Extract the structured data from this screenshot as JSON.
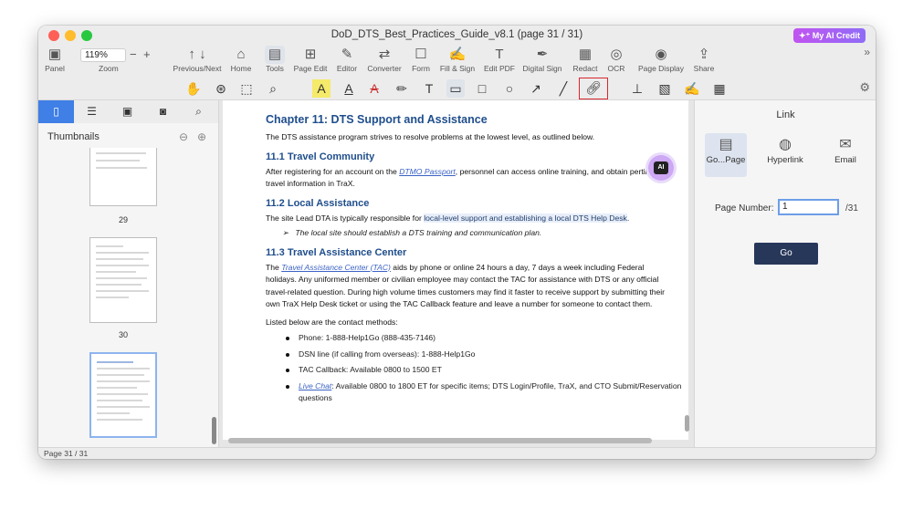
{
  "window": {
    "title": "DoD_DTS_Best_Practices_Guide_v8.1 (page 31 / 31)",
    "ai_credit": "✦⁺ My AI Credit"
  },
  "toolbar": {
    "panel": "Panel",
    "zoom_value": "119%",
    "zoom_label": "Zoom",
    "prevnext": "Previous/Next",
    "home": "Home",
    "tools": "Tools",
    "page_edit": "Page Edit",
    "editor": "Editor",
    "converter": "Converter",
    "form": "Form",
    "fill_sign": "Fill & Sign",
    "edit_pdf": "Edit PDF",
    "digital_sign": "Digital Sign",
    "redact": "Redact",
    "ocr": "OCR",
    "page_display": "Page Display",
    "share": "Share"
  },
  "sidebar": {
    "header": "Thumbnails",
    "pages": [
      "29",
      "30"
    ]
  },
  "doc": {
    "h1": "Chapter 11: DTS Support and Assistance",
    "p1": "The DTS assistance program strives to resolve problems at the lowest level, as outlined below.",
    "h2a": "11.1 Travel Community",
    "p2a": "After registering for an account on the ",
    "p2link": "DTMO Passport",
    "p2b": ", personnel can access online training, and obtain pertinent travel information in TraX.",
    "h2b": "11.2 Local Assistance",
    "p3a": "The site Lead DTA is typically responsible for ",
    "p3hl": "local-level support and establishing a local DTS Help Desk",
    "p3b": ".",
    "bullet": "The local site should establish a DTS training and communication plan.",
    "h2c": "11.3 Travel Assistance Center",
    "p4a": "The ",
    "p4link": "Travel Assistance Center (TAC)",
    "p4b": " aids by phone or online 24 hours a day, 7 days a week including Federal holidays. Any uniformed member or civilian employee may contact the TAC for assistance with DTS or any official travel-related question. During high volume times customers may find it faster to receive support by submitting their own TraX Help Desk ticket or using the TAC Callback feature and leave a number for someone to contact them.",
    "p5": "Listed below are the contact methods:",
    "li1": "Phone: 1-888-Help1Go (888-435-7146)",
    "li2": "DSN line (if calling from overseas):  1-888-Help1Go",
    "li3": "TAC Callback: Available 0800 to 1500 ET",
    "li4link": "Live Chat",
    "li4b": ": Available 0800 to 1800 ET for specific items; DTS Login/Profile, TraX, and CTO Submit/Reservation questions"
  },
  "link_panel": {
    "title": "Link",
    "tab_goto": "Go...Page",
    "tab_hyperlink": "Hyperlink",
    "tab_email": "Email",
    "page_number_label": "Page Number:",
    "page_number_value": "1",
    "page_total": "/31",
    "go": "Go"
  },
  "status": {
    "page": "Page 31 / 31"
  }
}
